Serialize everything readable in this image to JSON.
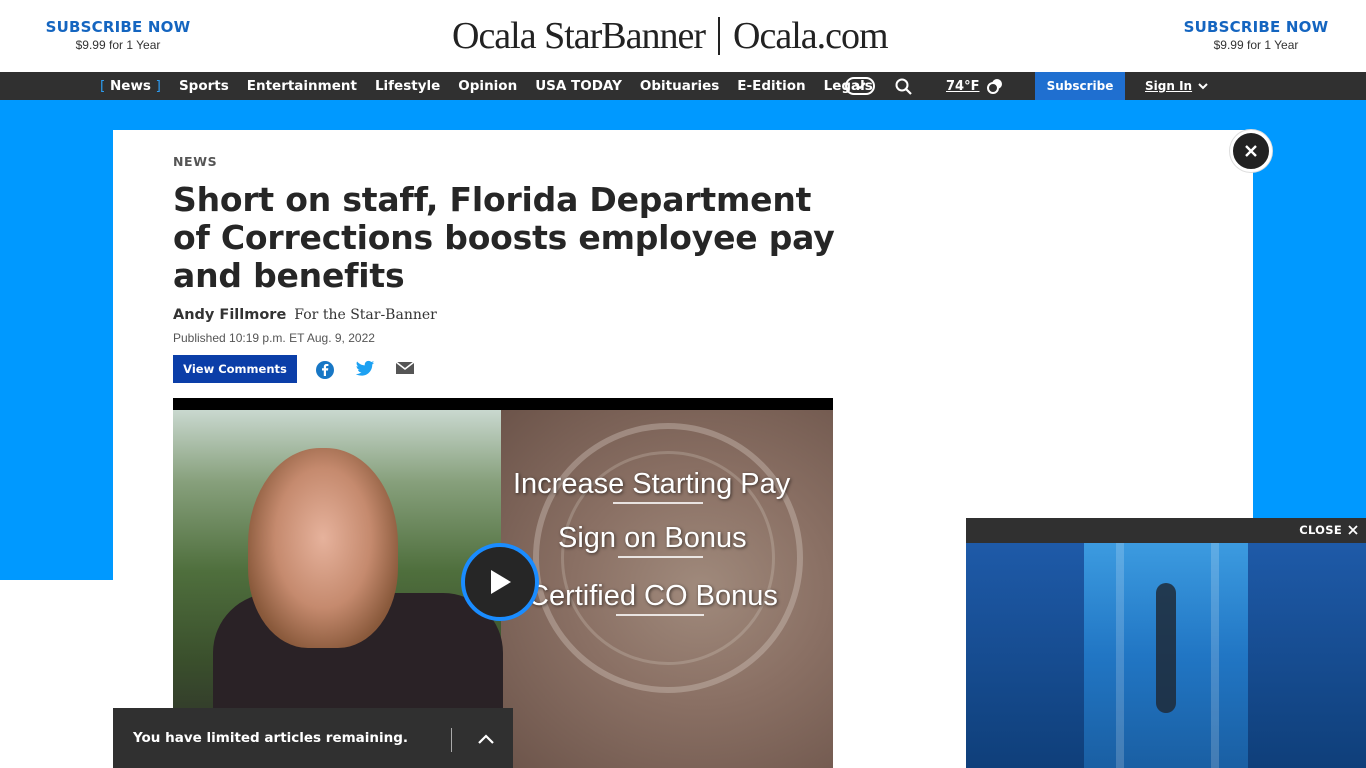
{
  "masthead": {
    "promo_left": {
      "title": "SUBSCRIBE NOW",
      "price": "$9.99 for 1 Year"
    },
    "promo_right": {
      "title": "SUBSCRIBE NOW",
      "price": "$9.99 for 1 Year"
    },
    "logo_left": "Ocala StarBanner",
    "logo_right": "Ocala.com"
  },
  "nav": {
    "items": [
      "News",
      "Sports",
      "Entertainment",
      "Lifestyle",
      "Opinion",
      "USA TODAY",
      "Obituaries",
      "E-Edition",
      "Legals"
    ],
    "active_open": "[",
    "active_close": "]",
    "temperature": "74°F",
    "subscribe": "Subscribe",
    "sign_in": "Sign In"
  },
  "article": {
    "section": "NEWS",
    "headline": "Short on staff, Florida Department of Corrections boosts employee pay and benefits",
    "author": "Andy Fillmore",
    "affiliation": "For the Star-Banner",
    "published": "Published 10:19 p.m. ET Aug. 9, 2022",
    "comments_button": "View Comments"
  },
  "video": {
    "overlay_lines": [
      "Increase Starting Pay",
      "Sign on Bonus",
      "Certified CO Bonus"
    ]
  },
  "limited_bar": {
    "text": "You have limited articles remaining."
  },
  "float_player": {
    "close_label": "CLOSE"
  },
  "colors": {
    "brand_blue": "#1465c0",
    "background_blue": "#0099ff",
    "nav_dark": "#303030",
    "comments_blue": "#0b3ea8"
  }
}
